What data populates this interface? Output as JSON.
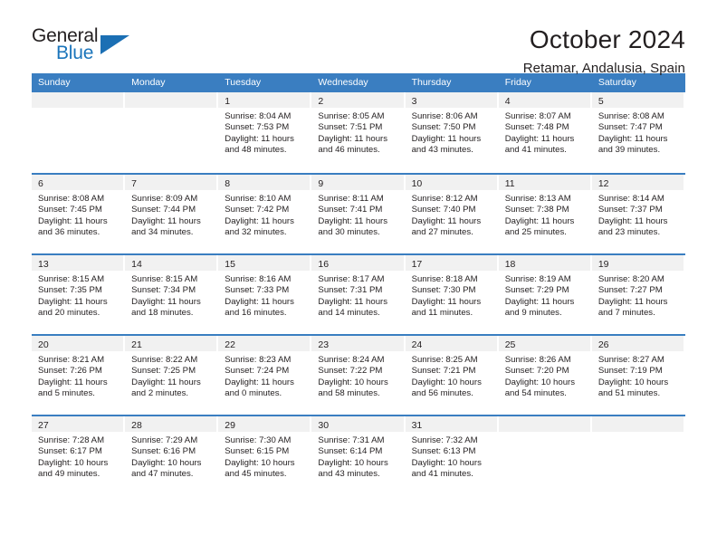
{
  "logo": {
    "word_one": "General",
    "word_two": "Blue",
    "triangle_color": "#1b6fb4",
    "blue_color": "#1b75bb"
  },
  "header": {
    "title": "October 2024",
    "subtitle": "Retamar, Andalusia, Spain"
  },
  "theme": {
    "header_blue": "#3a7ec1",
    "daynum_band": "#f1f1f1",
    "text": "#231f20"
  },
  "calendar": {
    "weekdays": [
      "Sunday",
      "Monday",
      "Tuesday",
      "Wednesday",
      "Thursday",
      "Friday",
      "Saturday"
    ],
    "weeks": [
      [
        {
          "day": "",
          "lines": []
        },
        {
          "day": "",
          "lines": []
        },
        {
          "day": "1",
          "lines": [
            "Sunrise: 8:04 AM",
            "Sunset: 7:53 PM",
            "Daylight: 11 hours",
            "and 48 minutes."
          ]
        },
        {
          "day": "2",
          "lines": [
            "Sunrise: 8:05 AM",
            "Sunset: 7:51 PM",
            "Daylight: 11 hours",
            "and 46 minutes."
          ]
        },
        {
          "day": "3",
          "lines": [
            "Sunrise: 8:06 AM",
            "Sunset: 7:50 PM",
            "Daylight: 11 hours",
            "and 43 minutes."
          ]
        },
        {
          "day": "4",
          "lines": [
            "Sunrise: 8:07 AM",
            "Sunset: 7:48 PM",
            "Daylight: 11 hours",
            "and 41 minutes."
          ]
        },
        {
          "day": "5",
          "lines": [
            "Sunrise: 8:08 AM",
            "Sunset: 7:47 PM",
            "Daylight: 11 hours",
            "and 39 minutes."
          ]
        }
      ],
      [
        {
          "day": "6",
          "lines": [
            "Sunrise: 8:08 AM",
            "Sunset: 7:45 PM",
            "Daylight: 11 hours",
            "and 36 minutes."
          ]
        },
        {
          "day": "7",
          "lines": [
            "Sunrise: 8:09 AM",
            "Sunset: 7:44 PM",
            "Daylight: 11 hours",
            "and 34 minutes."
          ]
        },
        {
          "day": "8",
          "lines": [
            "Sunrise: 8:10 AM",
            "Sunset: 7:42 PM",
            "Daylight: 11 hours",
            "and 32 minutes."
          ]
        },
        {
          "day": "9",
          "lines": [
            "Sunrise: 8:11 AM",
            "Sunset: 7:41 PM",
            "Daylight: 11 hours",
            "and 30 minutes."
          ]
        },
        {
          "day": "10",
          "lines": [
            "Sunrise: 8:12 AM",
            "Sunset: 7:40 PM",
            "Daylight: 11 hours",
            "and 27 minutes."
          ]
        },
        {
          "day": "11",
          "lines": [
            "Sunrise: 8:13 AM",
            "Sunset: 7:38 PM",
            "Daylight: 11 hours",
            "and 25 minutes."
          ]
        },
        {
          "day": "12",
          "lines": [
            "Sunrise: 8:14 AM",
            "Sunset: 7:37 PM",
            "Daylight: 11 hours",
            "and 23 minutes."
          ]
        }
      ],
      [
        {
          "day": "13",
          "lines": [
            "Sunrise: 8:15 AM",
            "Sunset: 7:35 PM",
            "Daylight: 11 hours",
            "and 20 minutes."
          ]
        },
        {
          "day": "14",
          "lines": [
            "Sunrise: 8:15 AM",
            "Sunset: 7:34 PM",
            "Daylight: 11 hours",
            "and 18 minutes."
          ]
        },
        {
          "day": "15",
          "lines": [
            "Sunrise: 8:16 AM",
            "Sunset: 7:33 PM",
            "Daylight: 11 hours",
            "and 16 minutes."
          ]
        },
        {
          "day": "16",
          "lines": [
            "Sunrise: 8:17 AM",
            "Sunset: 7:31 PM",
            "Daylight: 11 hours",
            "and 14 minutes."
          ]
        },
        {
          "day": "17",
          "lines": [
            "Sunrise: 8:18 AM",
            "Sunset: 7:30 PM",
            "Daylight: 11 hours",
            "and 11 minutes."
          ]
        },
        {
          "day": "18",
          "lines": [
            "Sunrise: 8:19 AM",
            "Sunset: 7:29 PM",
            "Daylight: 11 hours",
            "and 9 minutes."
          ]
        },
        {
          "day": "19",
          "lines": [
            "Sunrise: 8:20 AM",
            "Sunset: 7:27 PM",
            "Daylight: 11 hours",
            "and 7 minutes."
          ]
        }
      ],
      [
        {
          "day": "20",
          "lines": [
            "Sunrise: 8:21 AM",
            "Sunset: 7:26 PM",
            "Daylight: 11 hours",
            "and 5 minutes."
          ]
        },
        {
          "day": "21",
          "lines": [
            "Sunrise: 8:22 AM",
            "Sunset: 7:25 PM",
            "Daylight: 11 hours",
            "and 2 minutes."
          ]
        },
        {
          "day": "22",
          "lines": [
            "Sunrise: 8:23 AM",
            "Sunset: 7:24 PM",
            "Daylight: 11 hours",
            "and 0 minutes."
          ]
        },
        {
          "day": "23",
          "lines": [
            "Sunrise: 8:24 AM",
            "Sunset: 7:22 PM",
            "Daylight: 10 hours",
            "and 58 minutes."
          ]
        },
        {
          "day": "24",
          "lines": [
            "Sunrise: 8:25 AM",
            "Sunset: 7:21 PM",
            "Daylight: 10 hours",
            "and 56 minutes."
          ]
        },
        {
          "day": "25",
          "lines": [
            "Sunrise: 8:26 AM",
            "Sunset: 7:20 PM",
            "Daylight: 10 hours",
            "and 54 minutes."
          ]
        },
        {
          "day": "26",
          "lines": [
            "Sunrise: 8:27 AM",
            "Sunset: 7:19 PM",
            "Daylight: 10 hours",
            "and 51 minutes."
          ]
        }
      ],
      [
        {
          "day": "27",
          "lines": [
            "Sunrise: 7:28 AM",
            "Sunset: 6:17 PM",
            "Daylight: 10 hours",
            "and 49 minutes."
          ]
        },
        {
          "day": "28",
          "lines": [
            "Sunrise: 7:29 AM",
            "Sunset: 6:16 PM",
            "Daylight: 10 hours",
            "and 47 minutes."
          ]
        },
        {
          "day": "29",
          "lines": [
            "Sunrise: 7:30 AM",
            "Sunset: 6:15 PM",
            "Daylight: 10 hours",
            "and 45 minutes."
          ]
        },
        {
          "day": "30",
          "lines": [
            "Sunrise: 7:31 AM",
            "Sunset: 6:14 PM",
            "Daylight: 10 hours",
            "and 43 minutes."
          ]
        },
        {
          "day": "31",
          "lines": [
            "Sunrise: 7:32 AM",
            "Sunset: 6:13 PM",
            "Daylight: 10 hours",
            "and 41 minutes."
          ]
        },
        {
          "day": "",
          "lines": []
        },
        {
          "day": "",
          "lines": []
        }
      ]
    ]
  }
}
